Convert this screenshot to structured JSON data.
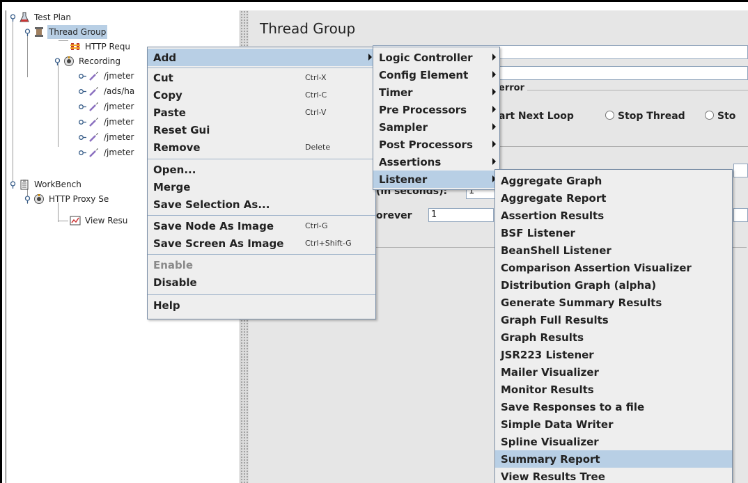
{
  "tree": {
    "test_plan": "Test Plan",
    "thread_group": "Thread Group",
    "http_request": "HTTP Requ",
    "recording": "Recording",
    "samplers": [
      "/jmeter",
      "/ads/ha",
      "/jmeter",
      "/jmeter",
      "/jmeter",
      "/jmeter"
    ],
    "workbench": "WorkBench",
    "http_proxy": "HTTP Proxy Se",
    "view_results": "View Resu"
  },
  "content": {
    "title": "Thread Group",
    "on_error_label": "error",
    "start_next_loop": "art Next Loop",
    "stop_thread": "Stop Thread",
    "stop_cut": "Sto",
    "ramp_label": "(in seconds):",
    "ramp_value": "1",
    "forever_label": "orever",
    "loop_value": "1"
  },
  "context_menu": {
    "add": "Add",
    "cut": "Cut",
    "cut_sc": "Ctrl-X",
    "copy": "Copy",
    "copy_sc": "Ctrl-C",
    "paste": "Paste",
    "paste_sc": "Ctrl-V",
    "reset_gui": "Reset Gui",
    "remove": "Remove",
    "remove_sc": "Delete",
    "open": "Open...",
    "merge": "Merge",
    "save_selection": "Save Selection As...",
    "save_node_image": "Save Node As Image",
    "save_node_image_sc": "Ctrl-G",
    "save_screen_image": "Save Screen As Image",
    "save_screen_image_sc": "Ctrl+Shift-G",
    "enable": "Enable",
    "disable": "Disable",
    "help": "Help"
  },
  "add_submenu": [
    "Logic Controller",
    "Config Element",
    "Timer",
    "Pre Processors",
    "Sampler",
    "Post Processors",
    "Assertions",
    "Listener"
  ],
  "listener_submenu": [
    "Aggregate Graph",
    "Aggregate Report",
    "Assertion Results",
    "BSF Listener",
    "BeanShell Listener",
    "Comparison Assertion Visualizer",
    "Distribution Graph (alpha)",
    "Generate Summary Results",
    "Graph Full Results",
    "Graph Results",
    "JSR223 Listener",
    "Mailer Visualizer",
    "Monitor Results",
    "Save Responses to a file",
    "Simple Data Writer",
    "Spline Visualizer",
    "Summary Report",
    "View Results Tree"
  ],
  "colors": {
    "selection": "#b8cfe5",
    "menu_bg": "#eeeeee",
    "panel_bg": "#e6e6e6"
  },
  "icons": {
    "toggle": "tree-toggle-icon",
    "test_plan": "flask-icon",
    "thread_group": "spool-icon",
    "http_request": "http-request-icon",
    "recording": "recording-controller-icon",
    "sampler": "pipette-icon",
    "workbench": "clipboard-icon",
    "listener": "graph-icon"
  }
}
